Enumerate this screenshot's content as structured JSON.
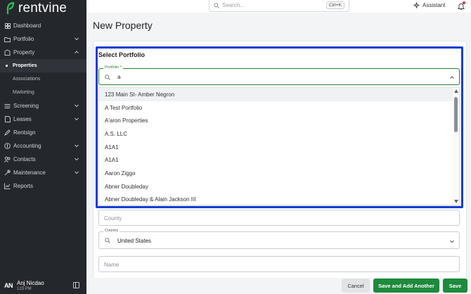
{
  "app": {
    "name": "rentvine"
  },
  "sidebar": {
    "items": [
      {
        "label": "Dashboard",
        "icon": "grid-icon",
        "chevron": false
      },
      {
        "label": "Portfolio",
        "icon": "folder-icon",
        "chevron": true
      },
      {
        "label": "Property",
        "icon": "building-icon",
        "chevron": true,
        "expanded": true
      },
      {
        "label": "Screening",
        "icon": "list-icon",
        "chevron": true
      },
      {
        "label": "Leases",
        "icon": "document-icon",
        "chevron": true
      },
      {
        "label": "Rentsign",
        "icon": "pen-icon",
        "chevron": false
      },
      {
        "label": "Accounting",
        "icon": "dollar-icon",
        "chevron": true
      },
      {
        "label": "Contacts",
        "icon": "people-icon",
        "chevron": true
      },
      {
        "label": "Maintenance",
        "icon": "wrench-icon",
        "chevron": true
      },
      {
        "label": "Reports",
        "icon": "chart-icon",
        "chevron": false
      }
    ],
    "property_sub": [
      "Properties",
      "Associations",
      "Marketing"
    ],
    "active_sub": "Properties"
  },
  "user": {
    "initials": "AN",
    "name": "Anj Nicdao",
    "sub": "123 PM"
  },
  "topbar": {
    "search_placeholder": "Search...",
    "shortcut": "Ctrl+K",
    "assistant_label": "Assistant"
  },
  "page": {
    "title": "New Property"
  },
  "form": {
    "section_title": "Select Portfolio",
    "portfolio_label": "Portfolio *",
    "portfolio_value": "a",
    "county_placeholder": "County",
    "country_label": "Country",
    "country_value": "United States",
    "name_placeholder": "Name"
  },
  "dropdown": {
    "options": [
      "123 Main St- Amber Negron",
      "A Test Portfolio",
      "A'aron Properties",
      "A.S. LLC",
      "A1A1",
      "A1A1",
      "Aaron Ziggo",
      "Abner Doubleday",
      "Abner Doubleday & Alain Jackson III"
    ]
  },
  "footer": {
    "cancel_label": "Cancel",
    "save_add_label": "Save and Add Another",
    "save_label": "Save"
  },
  "colors": {
    "accent_green": "#1e8a3c",
    "highlight_blue": "#0a3fd1",
    "sidebar_bg": "#24272c"
  }
}
